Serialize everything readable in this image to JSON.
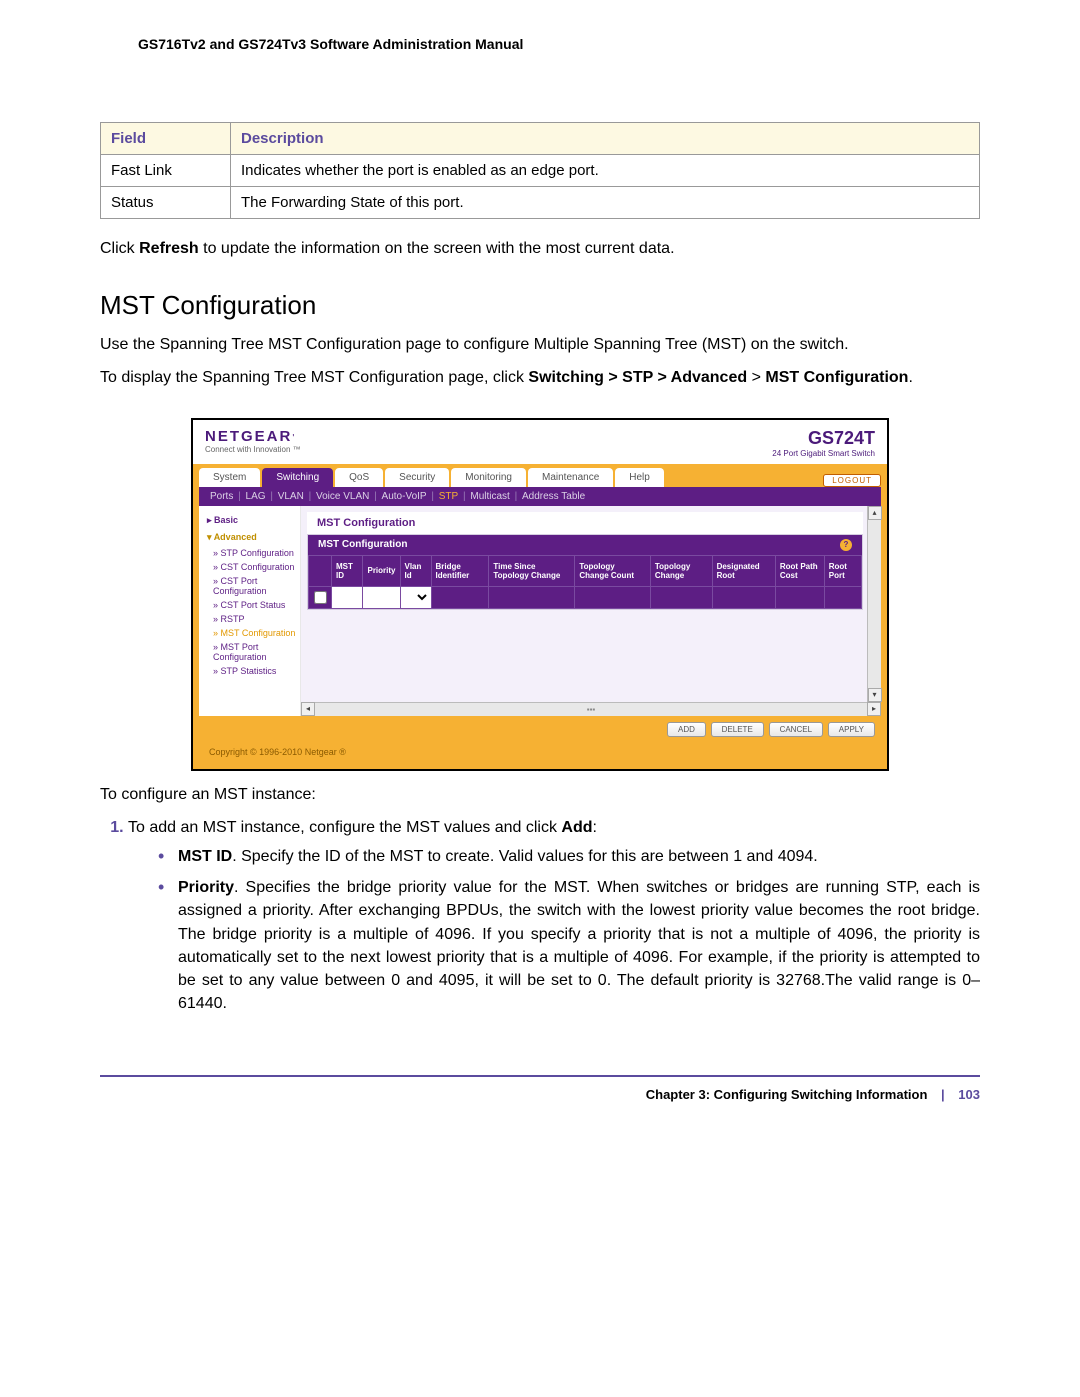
{
  "doc_header": "GS716Tv2 and GS724Tv3 Software Administration Manual",
  "table": {
    "headers": {
      "field": "Field",
      "description": "Description"
    },
    "rows": [
      {
        "field": "Fast Link",
        "description": "Indicates whether the port is enabled as an edge port."
      },
      {
        "field": "Status",
        "description": "The Forwarding State of this port."
      }
    ]
  },
  "refresh_line": {
    "pre": "Click ",
    "bold": "Refresh",
    "post": " to update the information on the screen with the most current data."
  },
  "section_title": "MST Configuration",
  "intro_para": "Use the Spanning Tree MST Configuration page to configure Multiple Spanning Tree (MST) on the switch.",
  "nav_line": {
    "pre": "To display the Spanning Tree MST Configuration page, click ",
    "bold1": "Switching > STP > Advanced",
    "mid": " > ",
    "bold2": "MST Configuration",
    "post": "."
  },
  "ui": {
    "brand": "NETGEAR",
    "brand_tag": "Connect with Innovation ™",
    "model": "GS724T",
    "model_sub": "24 Port Gigabit Smart Switch",
    "logout": "LOGOUT",
    "tabs": [
      {
        "label": "System",
        "active": false
      },
      {
        "label": "Switching",
        "active": true
      },
      {
        "label": "QoS",
        "active": false
      },
      {
        "label": "Security",
        "active": false
      },
      {
        "label": "Monitoring",
        "active": false
      },
      {
        "label": "Maintenance",
        "active": false
      },
      {
        "label": "Help",
        "active": false
      }
    ],
    "subnav": [
      "Ports",
      "LAG",
      "VLAN",
      "Voice VLAN",
      "Auto-VoIP",
      "STP",
      "Multicast",
      "Address Table"
    ],
    "subnav_active": "STP",
    "sidebar": {
      "basic": "Basic",
      "advanced": "Advanced",
      "items": [
        "STP Configuration",
        "CST Configuration",
        "CST Port Configuration",
        "CST Port Status",
        "RSTP",
        "MST Configuration",
        "MST Port Configuration",
        "STP Statistics"
      ],
      "current_index": 5
    },
    "panel_title": "MST Configuration",
    "panel_head": "MST Configuration",
    "columns": [
      "MST ID",
      "Priority",
      "Vlan Id",
      "Bridge Identifier",
      "Time Since Topology Change",
      "Topology Change Count",
      "Topology Change",
      "Designated Root",
      "Root Path Cost",
      "Root Port"
    ],
    "buttons": {
      "add": "ADD",
      "delete": "DELETE",
      "cancel": "CANCEL",
      "apply": "APPLY"
    },
    "copyright": "Copyright © 1996-2010 Netgear ®"
  },
  "configure_intro": "To configure an MST instance:",
  "step1": {
    "pre": "To add an MST instance, configure the MST values and click ",
    "bold": "Add",
    "post": ":"
  },
  "bullets": {
    "b1": {
      "bold": "MST ID",
      "text": ". Specify the ID of the MST to create. Valid values for this are between 1 and 4094."
    },
    "b2": {
      "bold": "Priority",
      "text": ". Specifies the bridge priority value for the MST. When switches or bridges are running STP, each is assigned a priority. After exchanging BPDUs, the switch with the lowest priority value becomes the root bridge. The bridge priority is a multiple of 4096. If you specify a priority that is not a multiple of 4096, the priority is automatically set to the next lowest priority that is a multiple of 4096. For example, if the priority is attempted to be set to any value between 0 and 4095, it will be set to 0. The default priority is 32768.The valid range is 0–61440."
    }
  },
  "footer": {
    "chapter": "Chapter 3:  Configuring Switching Information",
    "page": "103"
  }
}
